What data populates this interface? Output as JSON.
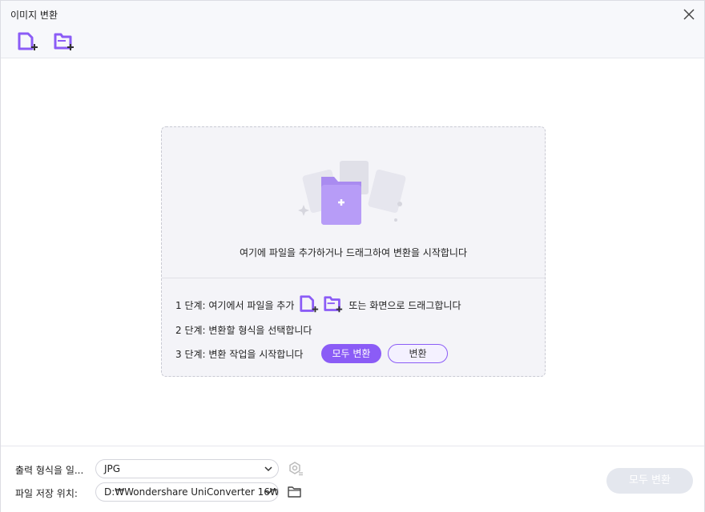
{
  "window": {
    "title": "이미지 변환"
  },
  "toolbar": {
    "add_file_icon": "add-file-icon",
    "add_folder_icon": "add-folder-icon",
    "close_icon": "close-icon"
  },
  "dropzone": {
    "hint": "여기에 파일을 추가하거나 드래그하여 변환을 시작합니다",
    "step1": "1 단계: 여기에서 파일을 추가",
    "step1_suffix": "또는 화면으로 드래그합니다",
    "step2": "2 단계: 변환할 형식을 선택합니다",
    "step3": "3 단계: 변환 작업을 시작합니다",
    "convert_all_label": "모두 변환",
    "convert_label": "변환"
  },
  "footer": {
    "output_format_label": "출력 형식을 일...",
    "output_format_value": "JPG",
    "save_location_label": "파일 저장 위치:",
    "save_location_value": "D:₩Wondershare UniConverter 16₩",
    "convert_all_button": "모두 변환"
  },
  "colors": {
    "accent": "#8b5cf6",
    "disabled_button": "#e4e7ee"
  }
}
